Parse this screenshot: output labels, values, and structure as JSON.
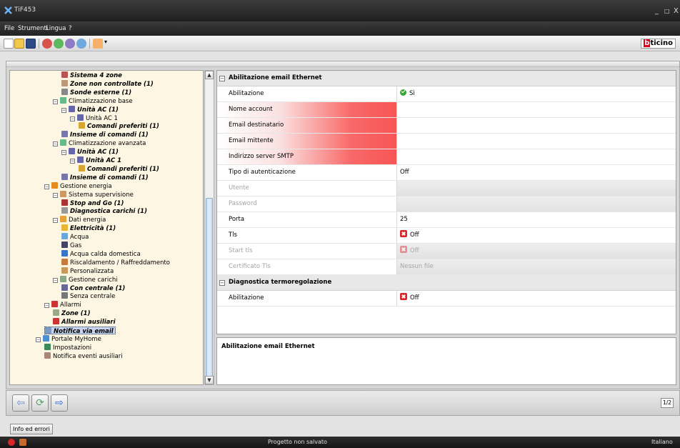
{
  "window": {
    "title": "TiF453",
    "minimize": "_",
    "maximize": "□",
    "close": "X"
  },
  "menu": [
    "File",
    "Strumenti",
    "Lingua",
    "?"
  ],
  "brand": {
    "part1": "b",
    "part2": "ticino"
  },
  "tree": [
    {
      "label": "Sistema 4 zone",
      "bold": true,
      "icon": "thermometer-icon"
    },
    {
      "label": "Zone non controllate (1)",
      "bold": true,
      "icon": "radiator-icon"
    },
    {
      "label": "Sonde esterne (1)",
      "bold": true,
      "icon": "probe-icon"
    },
    {
      "label": "Climatizzazione base",
      "bold": false,
      "icon": "air-conditioner-icon"
    },
    {
      "label": "Unità AC (1)",
      "bold": true,
      "icon": "ac-unit-icon"
    },
    {
      "label": "Unità AC 1",
      "bold": false,
      "icon": "ac-unit-icon"
    },
    {
      "label": "Comandi preferiti (1)",
      "bold": true,
      "icon": "folder-icon"
    },
    {
      "label": "Insieme di comandi (1)",
      "bold": true,
      "icon": "command-set-icon"
    },
    {
      "label": "Climatizzazione avanzata",
      "bold": false,
      "icon": "air-conditioner-icon"
    },
    {
      "label": "Unità AC (1)",
      "bold": true,
      "icon": "ac-unit-icon"
    },
    {
      "label": "Unità AC 1",
      "bold": true,
      "icon": "ac-unit-icon"
    },
    {
      "label": "Comandi preferiti (1)",
      "bold": true,
      "icon": "folder-icon"
    },
    {
      "label": "Insieme di comandi (1)",
      "bold": true,
      "icon": "command-set-icon"
    },
    {
      "label": "Gestione energia",
      "bold": false,
      "icon": "energy-icon"
    },
    {
      "label": "Sistema supervisione",
      "bold": false,
      "icon": "supervision-icon"
    },
    {
      "label": "Stop and Go (1)",
      "bold": true,
      "icon": "stop-and-go-icon"
    },
    {
      "label": "Diagnostica carichi (1)",
      "bold": true,
      "icon": "diagnostics-icon"
    },
    {
      "label": "Dati energia",
      "bold": false,
      "icon": "energy-data-icon"
    },
    {
      "label": "Elettricità (1)",
      "bold": true,
      "icon": "electricity-icon"
    },
    {
      "label": "Acqua",
      "bold": false,
      "icon": "water-icon"
    },
    {
      "label": "Gas",
      "bold": false,
      "icon": "gas-icon"
    },
    {
      "label": "Acqua calda domestica",
      "bold": false,
      "icon": "hot-water-icon"
    },
    {
      "label": "Riscaldamento / Raffreddamento",
      "bold": false,
      "icon": "heating-cooling-icon"
    },
    {
      "label": "Personalizzata",
      "bold": false,
      "icon": "custom-icon"
    },
    {
      "label": "Gestione carichi",
      "bold": false,
      "icon": "load-management-icon"
    },
    {
      "label": "Con centrale (1)",
      "bold": true,
      "icon": "central-unit-icon"
    },
    {
      "label": "Senza centrale",
      "bold": false,
      "icon": "no-central-icon"
    },
    {
      "label": "Allarmi",
      "bold": false,
      "icon": "alarm-icon"
    },
    {
      "label": "Zone (1)",
      "bold": true,
      "icon": "zone-icon"
    },
    {
      "label": "Allarmi ausiliari",
      "bold": true,
      "icon": "aux-alarm-icon"
    },
    {
      "label": "Notifica via email",
      "bold": true,
      "icon": "email-icon",
      "selected": true
    },
    {
      "label": "Portale MyHome",
      "bold": false,
      "icon": "globe-icon"
    },
    {
      "label": "Impostazioni",
      "bold": false,
      "icon": "settings-globe-icon"
    },
    {
      "label": "Notifica eventi ausiliari",
      "bold": false,
      "icon": "aux-events-icon"
    }
  ],
  "grid": {
    "section1": "Abilitazione email Ethernet",
    "rows1": [
      {
        "label": "Abilitazione",
        "value": "Sì",
        "state": "check"
      },
      {
        "label": "Nome account",
        "value": "",
        "state": "required"
      },
      {
        "label": "Email destinatario",
        "value": "",
        "state": "required"
      },
      {
        "label": "Email mittente",
        "value": "",
        "state": "required"
      },
      {
        "label": "Indirizzo server SMTP",
        "value": "",
        "state": "required"
      },
      {
        "label": "Tipo di autenticazione",
        "value": "Off",
        "state": "normal"
      },
      {
        "label": "Utente",
        "value": "",
        "state": "disabled"
      },
      {
        "label": "Password",
        "value": "",
        "state": "disabled"
      },
      {
        "label": "Porta",
        "value": "25",
        "state": "normal"
      },
      {
        "label": "Tls",
        "value": "Off",
        "state": "cross"
      },
      {
        "label": "Start tls",
        "value": "Off",
        "state": "cross-disabled"
      },
      {
        "label": "Certificato Tls",
        "value": "Nessun file",
        "state": "disabled"
      }
    ],
    "section2": "Diagnostica termoregolazione",
    "rows2": [
      {
        "label": "Abilitazione",
        "value": "Off",
        "state": "cross"
      }
    ]
  },
  "description": {
    "title": "Abilitazione email Ethernet"
  },
  "nav": {
    "back": "⇦",
    "refresh": "⟳",
    "forward": "⇨",
    "page": "1/2"
  },
  "errors_button": "Info ed errori",
  "status": {
    "project": "Progetto non salvato",
    "language": "Italiano"
  },
  "colors": {
    "required": "#f85555",
    "tree_bg": "#fdf6e3",
    "brand_red": "#e2001a",
    "check": "#3aa53a",
    "cross": "#d8262b"
  }
}
